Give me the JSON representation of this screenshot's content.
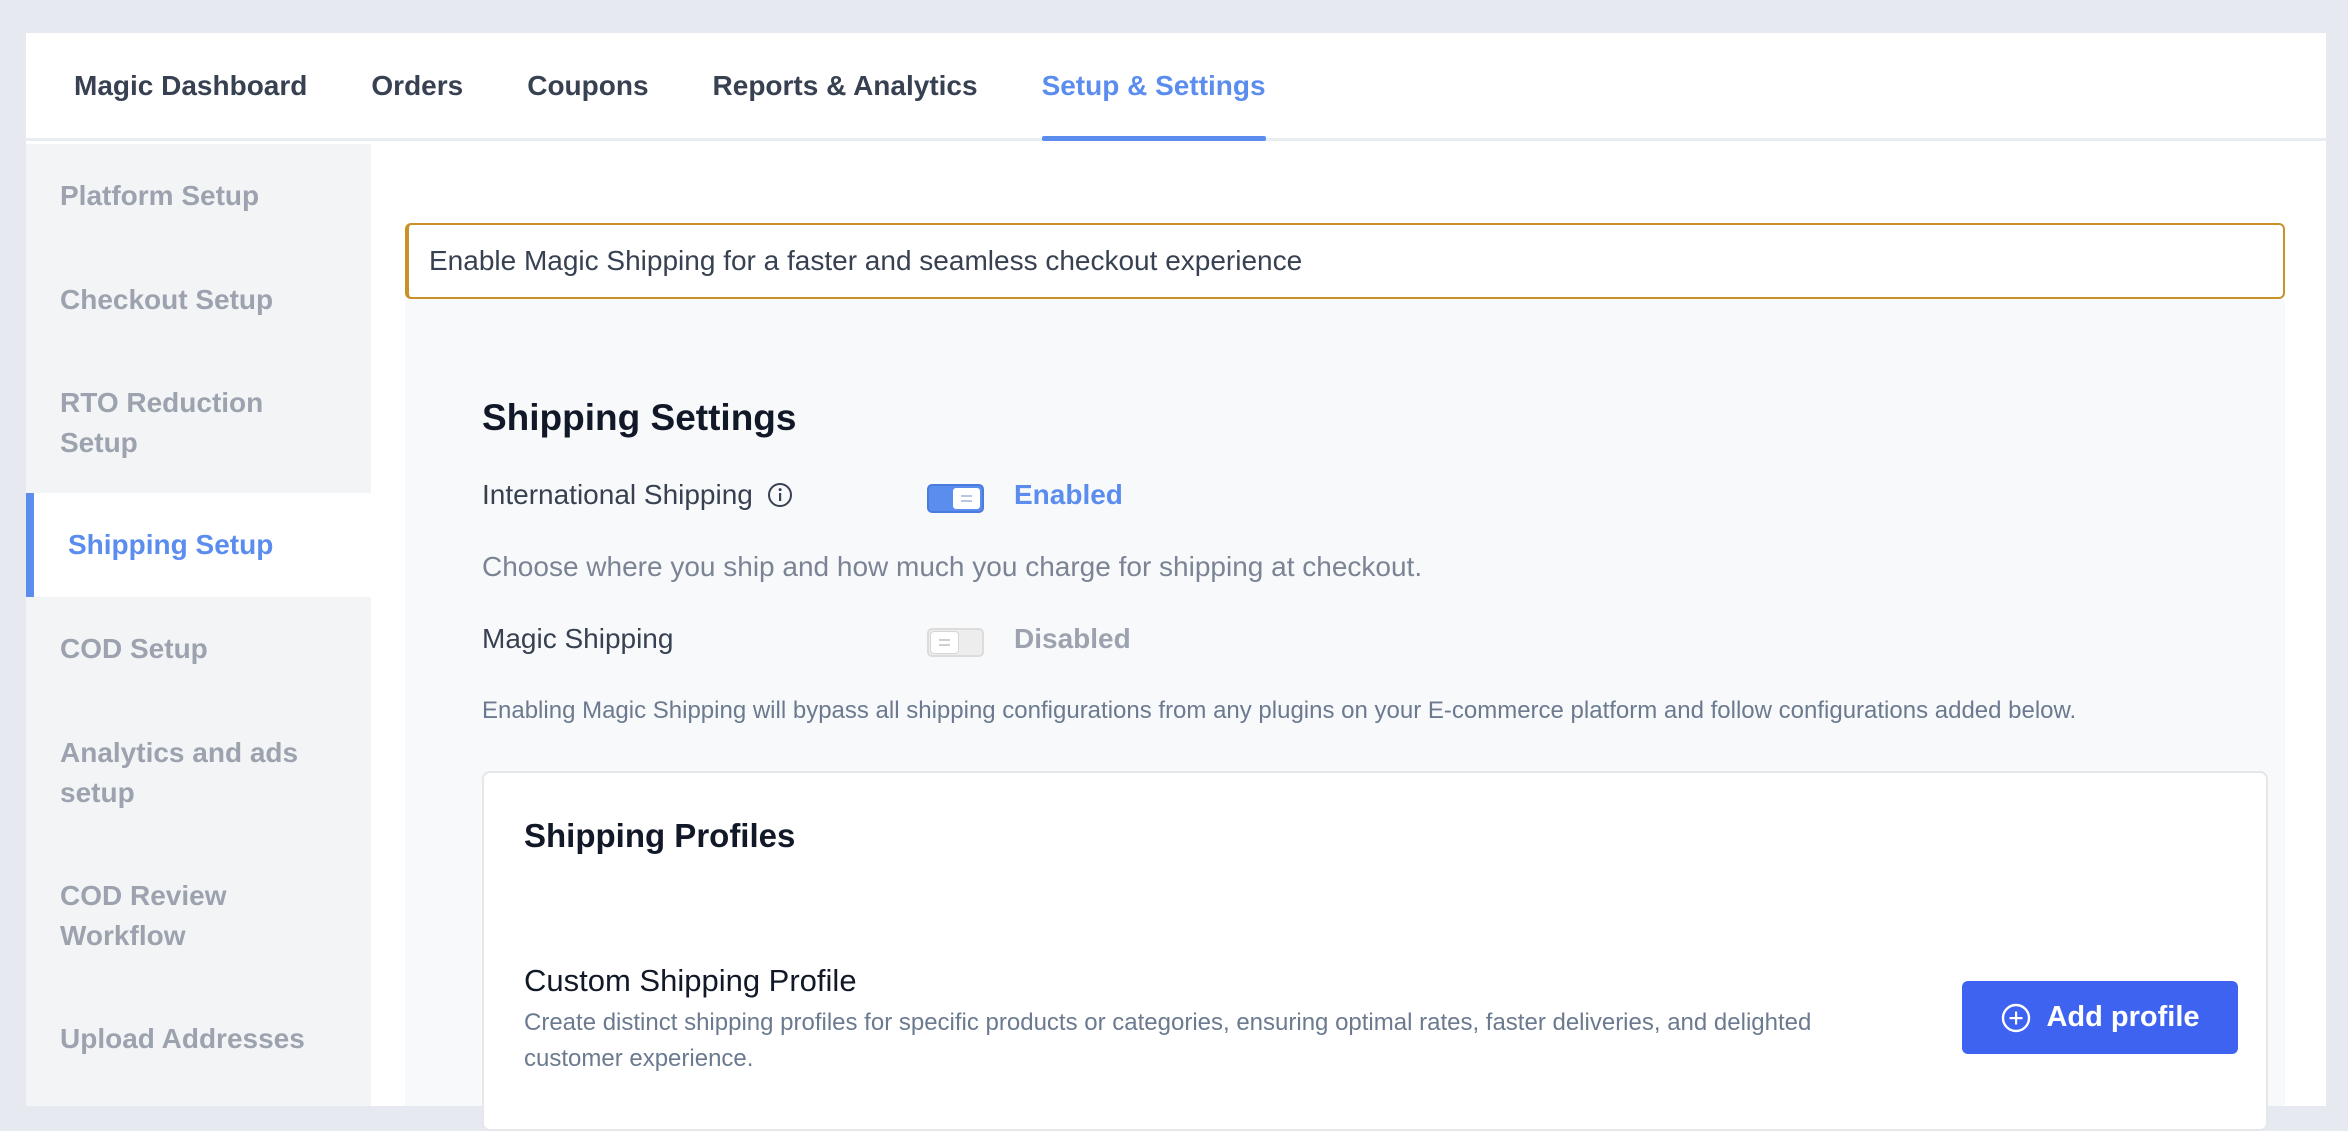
{
  "topnav": {
    "tabs": [
      {
        "label": "Magic Dashboard"
      },
      {
        "label": "Orders"
      },
      {
        "label": "Coupons"
      },
      {
        "label": "Reports & Analytics"
      },
      {
        "label": "Setup & Settings",
        "active": true
      }
    ]
  },
  "sidebar": {
    "items": [
      {
        "label": "Platform Setup"
      },
      {
        "label": "Checkout Setup"
      },
      {
        "label": "RTO Reduction Setup"
      },
      {
        "label": "Shipping Setup",
        "active": true
      },
      {
        "label": "COD Setup"
      },
      {
        "label": "Analytics and ads setup"
      },
      {
        "label": "COD Review Workflow"
      },
      {
        "label": "Upload Addresses"
      }
    ]
  },
  "banner": {
    "text": "Enable Magic Shipping for a faster and seamless checkout experience"
  },
  "shipping_settings": {
    "title": "Shipping Settings",
    "international": {
      "label": "International Shipping",
      "icon": "info-icon",
      "enabled": true,
      "status": "Enabled"
    },
    "choose_text": "Choose where you ship and how much you charge for shipping at checkout.",
    "magic": {
      "label": "Magic Shipping",
      "enabled": false,
      "status": "Disabled"
    },
    "note": "Enabling Magic Shipping will bypass all shipping configurations from any plugins on your E-commerce platform and follow configurations added below."
  },
  "shipping_profiles": {
    "title": "Shipping Profiles",
    "custom": {
      "title": "Custom Shipping Profile",
      "description": "Create distinct shipping profiles for specific products or categories, ensuring optimal rates, faster deliveries, and delighted customer experience.",
      "button": "Add profile",
      "button_icon": "plus-circle-icon"
    }
  },
  "colors": {
    "accent": "#5b8def",
    "button": "#3d63f0",
    "banner_border": "#c9912a"
  }
}
